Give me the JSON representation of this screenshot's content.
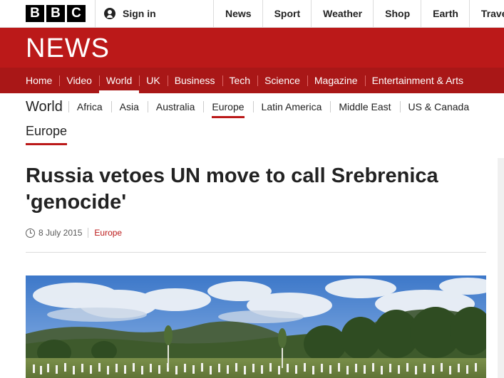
{
  "topbar": {
    "logo_letters": [
      "B",
      "B",
      "C"
    ],
    "signin_label": "Sign in",
    "links": [
      "News",
      "Sport",
      "Weather",
      "Shop",
      "Earth",
      "Travel"
    ]
  },
  "brand": {
    "news_logo": "NEWS"
  },
  "primary_nav": {
    "items": [
      "Home",
      "Video",
      "World",
      "UK",
      "Business",
      "Tech",
      "Science",
      "Magazine",
      "Entertainment & Arts"
    ],
    "active": "World"
  },
  "secondary_nav": {
    "section_title": "World",
    "items": [
      "Africa",
      "Asia",
      "Australia",
      "Europe",
      "Latin America",
      "Middle East",
      "US & Canada"
    ],
    "active": "Europe"
  },
  "subsection": "Europe",
  "article": {
    "headline": "Russia vetoes UN move to call Srebrenica 'genocide'",
    "date": "8 July 2015",
    "category": "Europe"
  },
  "colors": {
    "brand_red": "#bb1919",
    "nav_red": "#a91717"
  },
  "icons": {
    "signin": "user-icon",
    "date": "clock-icon"
  }
}
